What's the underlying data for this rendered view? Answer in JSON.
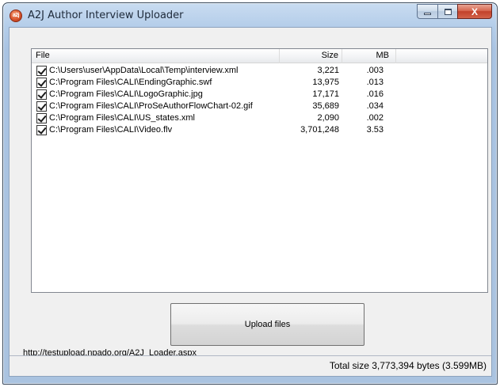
{
  "window": {
    "title": "A2J Author Interview Uploader",
    "icon_text": "a2j",
    "close_glyph": "X"
  },
  "list": {
    "columns": [
      "File",
      "Size",
      "MB"
    ],
    "rows": [
      {
        "checked": true,
        "file": "C:\\Users\\user\\AppData\\Local\\Temp\\interview.xml",
        "size": "3,221",
        "mb": ".003"
      },
      {
        "checked": true,
        "file": "C:\\Program Files\\CALI\\EndingGraphic.swf",
        "size": "13,975",
        "mb": ".013"
      },
      {
        "checked": true,
        "file": "C:\\Program Files\\CALI\\LogoGraphic.jpg",
        "size": "17,171",
        "mb": ".016"
      },
      {
        "checked": true,
        "file": "C:\\Program Files\\CALI\\ProSeAuthorFlowChart-02.gif",
        "size": "35,689",
        "mb": ".034"
      },
      {
        "checked": true,
        "file": "C:\\Program Files\\CALI\\US_states.xml",
        "size": "2,090",
        "mb": ".002"
      },
      {
        "checked": true,
        "file": "C:\\Program Files\\CALI\\Video.flv",
        "size": "3,701,248",
        "mb": "3.53"
      }
    ]
  },
  "actions": {
    "upload_label": "Upload files"
  },
  "url": "http://testupload.npado.org/A2J_Loader.aspx",
  "status": {
    "total_text": "Total size 3,773,394 bytes (3.599MB)"
  },
  "colors": {
    "title_bar": "#b4cde9",
    "close_button": "#c2412a"
  }
}
